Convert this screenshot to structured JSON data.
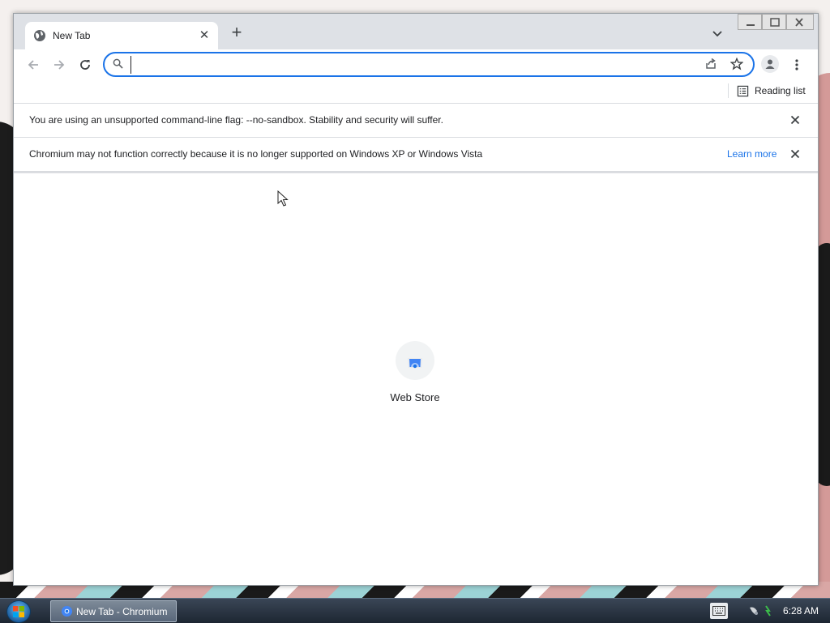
{
  "browser": {
    "tab": {
      "title": "New Tab"
    },
    "omnibox": {
      "value": "",
      "placeholder": ""
    },
    "bookmarks": {
      "reading_list_label": "Reading list"
    },
    "infobars": [
      {
        "message": "You are using an unsupported command-line flag: --no-sandbox. Stability and security will suffer."
      },
      {
        "message": "Chromium may not function correctly because it is no longer supported on Windows XP or Windows Vista",
        "link": "Learn more"
      }
    ],
    "new_tab_page": {
      "shortcuts": [
        {
          "label": "Web Store",
          "icon": "web-store-icon"
        }
      ]
    }
  },
  "taskbar": {
    "items": [
      {
        "label": "New Tab - Chromium"
      }
    ],
    "clock": "6:28 AM"
  },
  "colors": {
    "accent": "#1a73e8",
    "tabstrip": "#dee1e6",
    "taskbar": "#2a3442"
  }
}
